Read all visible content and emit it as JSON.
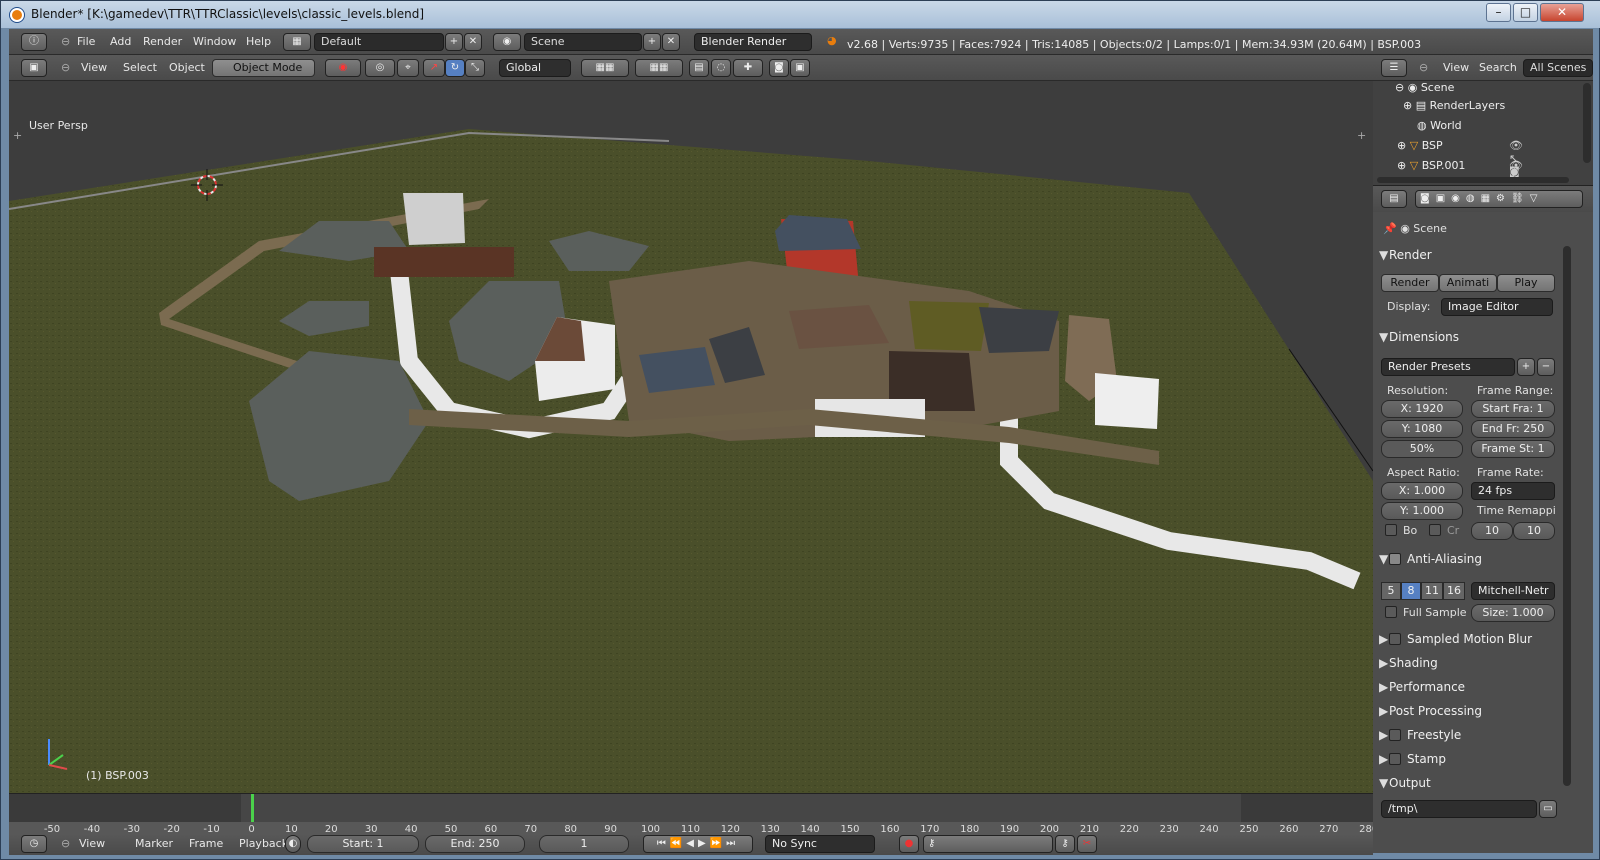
{
  "window": {
    "title": "Blender* [K:\\gamedev\\TTR\\TTRClassic\\levels\\classic_levels.blend]",
    "min": "–",
    "max": "□",
    "close": "✕"
  },
  "info_header": {
    "menus": [
      "File",
      "Add",
      "Render",
      "Window",
      "Help"
    ],
    "layout": "Default",
    "scene": "Scene",
    "engine": "Blender Render",
    "stats": "v2.68 | Verts:9735 | Faces:7924 | Tris:14085 | Objects:0/2 | Lamps:0/1 | Mem:34.93M (20.64M) | BSP.003"
  },
  "view3d_header": {
    "menus": [
      "View",
      "Select",
      "Object"
    ],
    "mode": "Object Mode",
    "orientation": "Global"
  },
  "viewport": {
    "view_label": "User Persp",
    "object_label": "(1) BSP.003"
  },
  "timeline": {
    "ticks": [
      "-50",
      "-40",
      "-30",
      "-20",
      "-10",
      "0",
      "10",
      "20",
      "30",
      "40",
      "50",
      "60",
      "70",
      "80",
      "90",
      "100",
      "110",
      "120",
      "130",
      "140",
      "150",
      "160",
      "170",
      "180",
      "190",
      "200",
      "210",
      "220",
      "230",
      "240",
      "250",
      "260",
      "270",
      "280"
    ],
    "menus": [
      "View",
      "Marker",
      "Frame",
      "Playback"
    ],
    "start": "Start: 1",
    "end": "End: 250",
    "current": "1",
    "sync": "No Sync"
  },
  "outliner": {
    "menus": [
      "View",
      "Search"
    ],
    "filter": "All Scenes",
    "items": [
      "Scene",
      "RenderLayers",
      "World",
      "BSP",
      "BSP.001"
    ]
  },
  "properties": {
    "context": "Scene",
    "render": {
      "title": "Render",
      "render_btn": "Render",
      "anim_btn": "Animati",
      "play_btn": "Play",
      "display_label": "Display:",
      "display_value": "Image Editor"
    },
    "dimensions": {
      "title": "Dimensions",
      "presets": "Render Presets",
      "resolution_label": "Resolution:",
      "res_x": "X: 1920",
      "res_y": "Y: 1080",
      "res_pct": "50%",
      "frame_range_label": "Frame Range:",
      "start_frame": "Start Fra: 1",
      "end_frame": "End Fr: 250",
      "frame_step": "Frame St: 1",
      "aspect_label": "Aspect Ratio:",
      "aspect_x": "X: 1.000",
      "aspect_y": "Y: 1.000",
      "frame_rate_label": "Frame Rate:",
      "frame_rate": "24 fps",
      "remap_label": "Time Remappi",
      "remap_old": "10",
      "remap_new": "10",
      "border": "Bo",
      "crop": "Cr"
    },
    "aa": {
      "title": "Anti-Aliasing",
      "samples": [
        "5",
        "8",
        "11",
        "16"
      ],
      "filter": "Mitchell-Netr",
      "full_sample": "Full Sample",
      "size": "Size: 1.000"
    },
    "panels": [
      "Sampled Motion Blur",
      "Shading",
      "Performance",
      "Post Processing",
      "Freestyle",
      "Stamp"
    ],
    "output": {
      "title": "Output",
      "path": "/tmp\\"
    }
  },
  "colors": {
    "grass": "#4a4f2a",
    "sky": "#3d3d3d",
    "accent": "#5680c2",
    "road": "#e8e8e8"
  }
}
